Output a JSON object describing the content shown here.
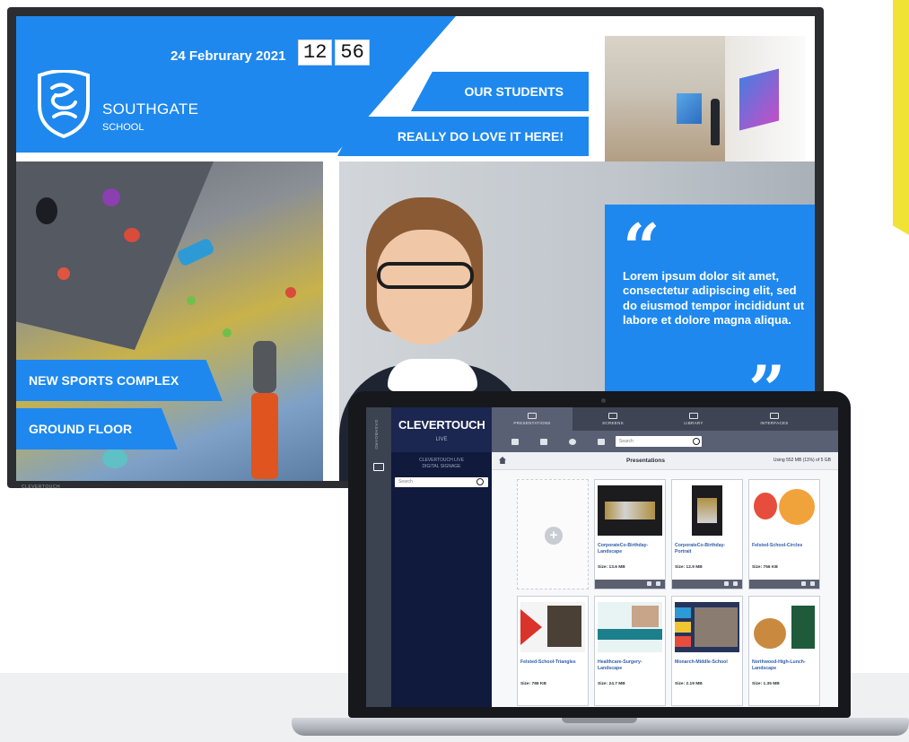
{
  "display": {
    "date": "24 Februrary 2021",
    "clock_hours": "12",
    "clock_minutes": "56",
    "school_name": "SOUTHGATE",
    "school_sub": "SCHOOL",
    "banner_1": "OUR STUDENTS",
    "banner_2": "REALLY DO LOVE IT HERE!",
    "banner_3": "NEW SPORTS COMPLEX",
    "banner_4": "GROUND FLOOR",
    "quote_text": "Lorem ipsum dolor sit amet, consectetur adipiscing elit, sed do eiusmod tempor incididunt ut labore et dolore magna aliqua.",
    "bezel_brand": "CLEVERTOUCH",
    "accent_color": "#1e88ee"
  },
  "app": {
    "rail_label": "DASHBOARD",
    "logo": "CLEVERTOUCH",
    "logo_sub": "LIVE",
    "sidebar_caption_1": "CLEVERTOUCH LIVE",
    "sidebar_caption_2": "DIGITAL SIGNAGE",
    "sidebar_search_placeholder": "Search",
    "tabs": [
      {
        "label": "PRESENTATIONS",
        "icon": "presentation-icon"
      },
      {
        "label": "SCREENS",
        "icon": "monitor-icon"
      },
      {
        "label": "LIBRARY",
        "icon": "library-icon"
      },
      {
        "label": "INTERFACES",
        "icon": "users-icon"
      }
    ],
    "top_search_placeholder": "Search",
    "breadcrumb_title": "Presentations",
    "storage_usage": "Using 552 MB (11%) of 5 GB",
    "presentations": [
      {
        "title": "CorporateCo-Birthday-Landscape",
        "size": "Size: 13.6 MB"
      },
      {
        "title": "CorporateCo-Birthday-Portrait",
        "size": "Size: 12.9 MB"
      },
      {
        "title": "Felsted-School-Circles",
        "size": "Size: 756 KB"
      },
      {
        "title": "Felsted-School-Triangles",
        "size": "Size: 786 KB"
      },
      {
        "title": "Healthcare-Surgery-Landscape",
        "size": "Size: 24.7 MB"
      },
      {
        "title": "Monarch-Middle-School",
        "size": "Size: 2.19 MB"
      },
      {
        "title": "Northwood-High-Lunch-Landscape",
        "size": "Size: 1.35 MB"
      }
    ]
  }
}
